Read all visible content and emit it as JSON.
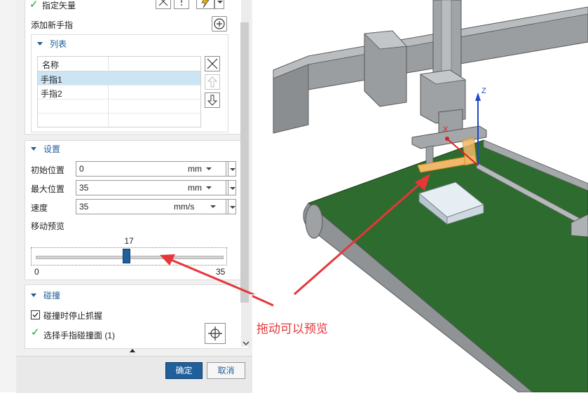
{
  "vector_section": {
    "label": "指定矢量"
  },
  "fingers": {
    "add_label": "添加新手指",
    "list_header": "列表",
    "column_name": "名称",
    "items": [
      "手指1",
      "手指2"
    ]
  },
  "settings": {
    "header": "设置",
    "initial_position": {
      "label": "初始位置",
      "value": "0",
      "unit": "mm"
    },
    "max_position": {
      "label": "最大位置",
      "value": "35",
      "unit": "mm"
    },
    "speed": {
      "label": "速度",
      "value": "35",
      "unit": "mm/s"
    },
    "preview": {
      "label": "移动预览",
      "current": "17",
      "min": "0",
      "max": "35",
      "fraction": 0.486
    }
  },
  "collision": {
    "header": "碰撞",
    "stop_grip_label": "碰撞时停止抓握",
    "stop_grip_checked": true,
    "select_face_label": "选择手指碰撞面 (1)"
  },
  "footer": {
    "ok": "确定",
    "cancel": "取消"
  },
  "viewport": {
    "annotation": "拖动可以预览",
    "axis_z": "Z",
    "axis_x": "X"
  },
  "colors": {
    "accent": "#1f5f9b",
    "ok_button": "#1f5f9b",
    "annotation": "#e5363a",
    "check": "#1aa33c"
  }
}
